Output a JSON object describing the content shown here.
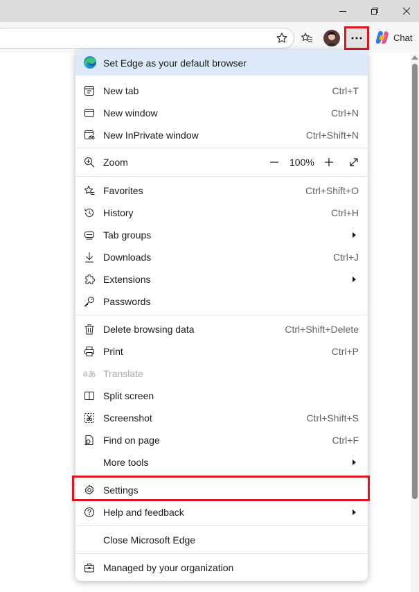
{
  "toolbar": {
    "chat_label": "Chat"
  },
  "icons": {
    "minimize": "minimize-icon",
    "restore": "restore-icon",
    "close": "close-icon",
    "favorite": "star-icon",
    "favorites": "favorites-icon",
    "more": "more-icon",
    "copilot": "copilot-icon"
  },
  "colors": {
    "highlight": "#e0141e",
    "banner": "#deeafa",
    "accent": "#0078d4"
  },
  "menu": {
    "banner": "Set Edge as your default browser",
    "new_tab": {
      "label": "New tab",
      "shortcut": "Ctrl+T"
    },
    "new_window": {
      "label": "New window",
      "shortcut": "Ctrl+N"
    },
    "new_inprivate": {
      "label": "New InPrivate window",
      "shortcut": "Ctrl+Shift+N"
    },
    "zoom": {
      "label": "Zoom",
      "value": "100%",
      "minus": "—",
      "plus": "+"
    },
    "favorites": {
      "label": "Favorites",
      "shortcut": "Ctrl+Shift+O"
    },
    "history": {
      "label": "History",
      "shortcut": "Ctrl+H"
    },
    "tab_groups": {
      "label": "Tab groups"
    },
    "downloads": {
      "label": "Downloads",
      "shortcut": "Ctrl+J"
    },
    "extensions": {
      "label": "Extensions"
    },
    "passwords": {
      "label": "Passwords"
    },
    "delete_browsing": {
      "label": "Delete browsing data",
      "shortcut": "Ctrl+Shift+Delete"
    },
    "print": {
      "label": "Print",
      "shortcut": "Ctrl+P"
    },
    "translate": {
      "label": "Translate"
    },
    "split_screen": {
      "label": "Split screen"
    },
    "screenshot": {
      "label": "Screenshot",
      "shortcut": "Ctrl+Shift+S"
    },
    "find_on_page": {
      "label": "Find on page",
      "shortcut": "Ctrl+F"
    },
    "more_tools": {
      "label": "More tools"
    },
    "settings": {
      "label": "Settings"
    },
    "help": {
      "label": "Help and feedback"
    },
    "close_edge": {
      "label": "Close Microsoft Edge"
    },
    "managed": {
      "label": "Managed by your organization"
    }
  }
}
